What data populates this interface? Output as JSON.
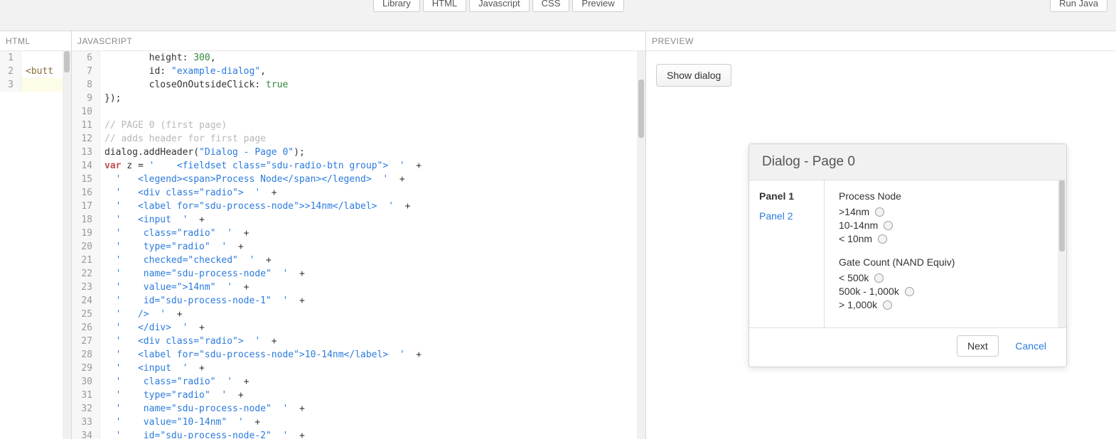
{
  "toolbar": {
    "tabs": [
      "Library",
      "HTML",
      "Javascript",
      "CSS",
      "Preview"
    ],
    "run_label": "Run Java"
  },
  "panels": {
    "html_label": "HTML",
    "js_label": "JAVASCRIPT",
    "preview_label": "PREVIEW"
  },
  "html_editor": {
    "lines": [
      {
        "n": 1,
        "text": ""
      },
      {
        "n": 2,
        "text": "<butt"
      },
      {
        "n": 3,
        "text": "",
        "cursor": true
      }
    ]
  },
  "js_editor": {
    "lines": [
      {
        "n": 6,
        "tokens": [
          [
            "        height: ",
            "key"
          ],
          [
            "300",
            "num"
          ],
          [
            ",",
            "key"
          ]
        ]
      },
      {
        "n": 7,
        "tokens": [
          [
            "        id: ",
            "key"
          ],
          [
            "\"example-dialog\"",
            "str"
          ],
          [
            ",",
            "key"
          ]
        ]
      },
      {
        "n": 8,
        "tokens": [
          [
            "        closeOnOutsideClick: ",
            "key"
          ],
          [
            "true",
            "num"
          ]
        ]
      },
      {
        "n": 9,
        "tokens": [
          [
            "});",
            "key"
          ]
        ]
      },
      {
        "n": 10,
        "tokens": [
          [
            "",
            "key"
          ]
        ]
      },
      {
        "n": 11,
        "tokens": [
          [
            "// PAGE 0 (first page)",
            "com"
          ]
        ]
      },
      {
        "n": 12,
        "tokens": [
          [
            "// adds header for first page",
            "com"
          ]
        ]
      },
      {
        "n": 13,
        "tokens": [
          [
            "dialog.addHeader(",
            "key"
          ],
          [
            "\"Dialog - Page 0\"",
            "str"
          ],
          [
            ");",
            "key"
          ]
        ]
      },
      {
        "n": 14,
        "tokens": [
          [
            "var",
            "var"
          ],
          [
            " z = ",
            "key"
          ],
          [
            "'    <fieldset class=\"sdu-radio-btn group\">  '",
            "str"
          ],
          [
            "  +",
            "plus"
          ]
        ]
      },
      {
        "n": 15,
        "tokens": [
          [
            "  ",
            "key"
          ],
          [
            "'   <legend><span>Process Node</span></legend>  '",
            "str"
          ],
          [
            "  +",
            "plus"
          ]
        ]
      },
      {
        "n": 16,
        "tokens": [
          [
            "  ",
            "key"
          ],
          [
            "'   <div class=\"radio\">  '",
            "str"
          ],
          [
            "  +",
            "plus"
          ]
        ]
      },
      {
        "n": 17,
        "tokens": [
          [
            "  ",
            "key"
          ],
          [
            "'   <label for=\"sdu-process-node\">>14nm</label>  '",
            "str"
          ],
          [
            "  +",
            "plus"
          ]
        ]
      },
      {
        "n": 18,
        "tokens": [
          [
            "  ",
            "key"
          ],
          [
            "'   <input  '",
            "str"
          ],
          [
            "  +",
            "plus"
          ]
        ]
      },
      {
        "n": 19,
        "tokens": [
          [
            "  ",
            "key"
          ],
          [
            "'    class=\"radio\"  '",
            "str"
          ],
          [
            "  +",
            "plus"
          ]
        ]
      },
      {
        "n": 20,
        "tokens": [
          [
            "  ",
            "key"
          ],
          [
            "'    type=\"radio\"  '",
            "str"
          ],
          [
            "  +",
            "plus"
          ]
        ]
      },
      {
        "n": 21,
        "tokens": [
          [
            "  ",
            "key"
          ],
          [
            "'    checked=\"checked\"  '",
            "str"
          ],
          [
            "  +",
            "plus"
          ]
        ]
      },
      {
        "n": 22,
        "tokens": [
          [
            "  ",
            "key"
          ],
          [
            "'    name=\"sdu-process-node\"  '",
            "str"
          ],
          [
            "  +",
            "plus"
          ]
        ]
      },
      {
        "n": 23,
        "tokens": [
          [
            "  ",
            "key"
          ],
          [
            "'    value=\">14nm\"  '",
            "str"
          ],
          [
            "  +",
            "plus"
          ]
        ]
      },
      {
        "n": 24,
        "tokens": [
          [
            "  ",
            "key"
          ],
          [
            "'    id=\"sdu-process-node-1\"  '",
            "str"
          ],
          [
            "  +",
            "plus"
          ]
        ]
      },
      {
        "n": 25,
        "tokens": [
          [
            "  ",
            "key"
          ],
          [
            "'   />  '",
            "str"
          ],
          [
            "  +",
            "plus"
          ]
        ]
      },
      {
        "n": 26,
        "tokens": [
          [
            "  ",
            "key"
          ],
          [
            "'   </div>  '",
            "str"
          ],
          [
            "  +",
            "plus"
          ]
        ]
      },
      {
        "n": 27,
        "tokens": [
          [
            "  ",
            "key"
          ],
          [
            "'   <div class=\"radio\">  '",
            "str"
          ],
          [
            "  +",
            "plus"
          ]
        ]
      },
      {
        "n": 28,
        "tokens": [
          [
            "  ",
            "key"
          ],
          [
            "'   <label for=\"sdu-process-node\">10-14nm</label>  '",
            "str"
          ],
          [
            "  +",
            "plus"
          ]
        ]
      },
      {
        "n": 29,
        "tokens": [
          [
            "  ",
            "key"
          ],
          [
            "'   <input  '",
            "str"
          ],
          [
            "  +",
            "plus"
          ]
        ]
      },
      {
        "n": 30,
        "tokens": [
          [
            "  ",
            "key"
          ],
          [
            "'    class=\"radio\"  '",
            "str"
          ],
          [
            "  +",
            "plus"
          ]
        ]
      },
      {
        "n": 31,
        "tokens": [
          [
            "  ",
            "key"
          ],
          [
            "'    type=\"radio\"  '",
            "str"
          ],
          [
            "  +",
            "plus"
          ]
        ]
      },
      {
        "n": 32,
        "tokens": [
          [
            "  ",
            "key"
          ],
          [
            "'    name=\"sdu-process-node\"  '",
            "str"
          ],
          [
            "  +",
            "plus"
          ]
        ]
      },
      {
        "n": 33,
        "tokens": [
          [
            "  ",
            "key"
          ],
          [
            "'    value=\"10-14nm\"  '",
            "str"
          ],
          [
            "  +",
            "plus"
          ]
        ]
      },
      {
        "n": 34,
        "tokens": [
          [
            "  ",
            "key"
          ],
          [
            "'    id=\"sdu-process-node-2\"  '",
            "str"
          ],
          [
            "  +",
            "plus"
          ]
        ]
      }
    ]
  },
  "preview": {
    "show_dialog_label": "Show dialog",
    "dialog": {
      "title": "Dialog - Page 0",
      "panels": [
        {
          "label": "Panel 1",
          "active": true
        },
        {
          "label": "Panel 2",
          "active": false
        }
      ],
      "groups": [
        {
          "title": "Process Node",
          "options": [
            ">14nm",
            "10-14nm",
            "< 10nm"
          ]
        },
        {
          "title": "Gate Count (NAND Equiv)",
          "options": [
            "< 500k",
            "500k - 1,000k",
            "> 1,000k"
          ]
        }
      ],
      "buttons": {
        "next": "Next",
        "cancel": "Cancel"
      }
    }
  }
}
